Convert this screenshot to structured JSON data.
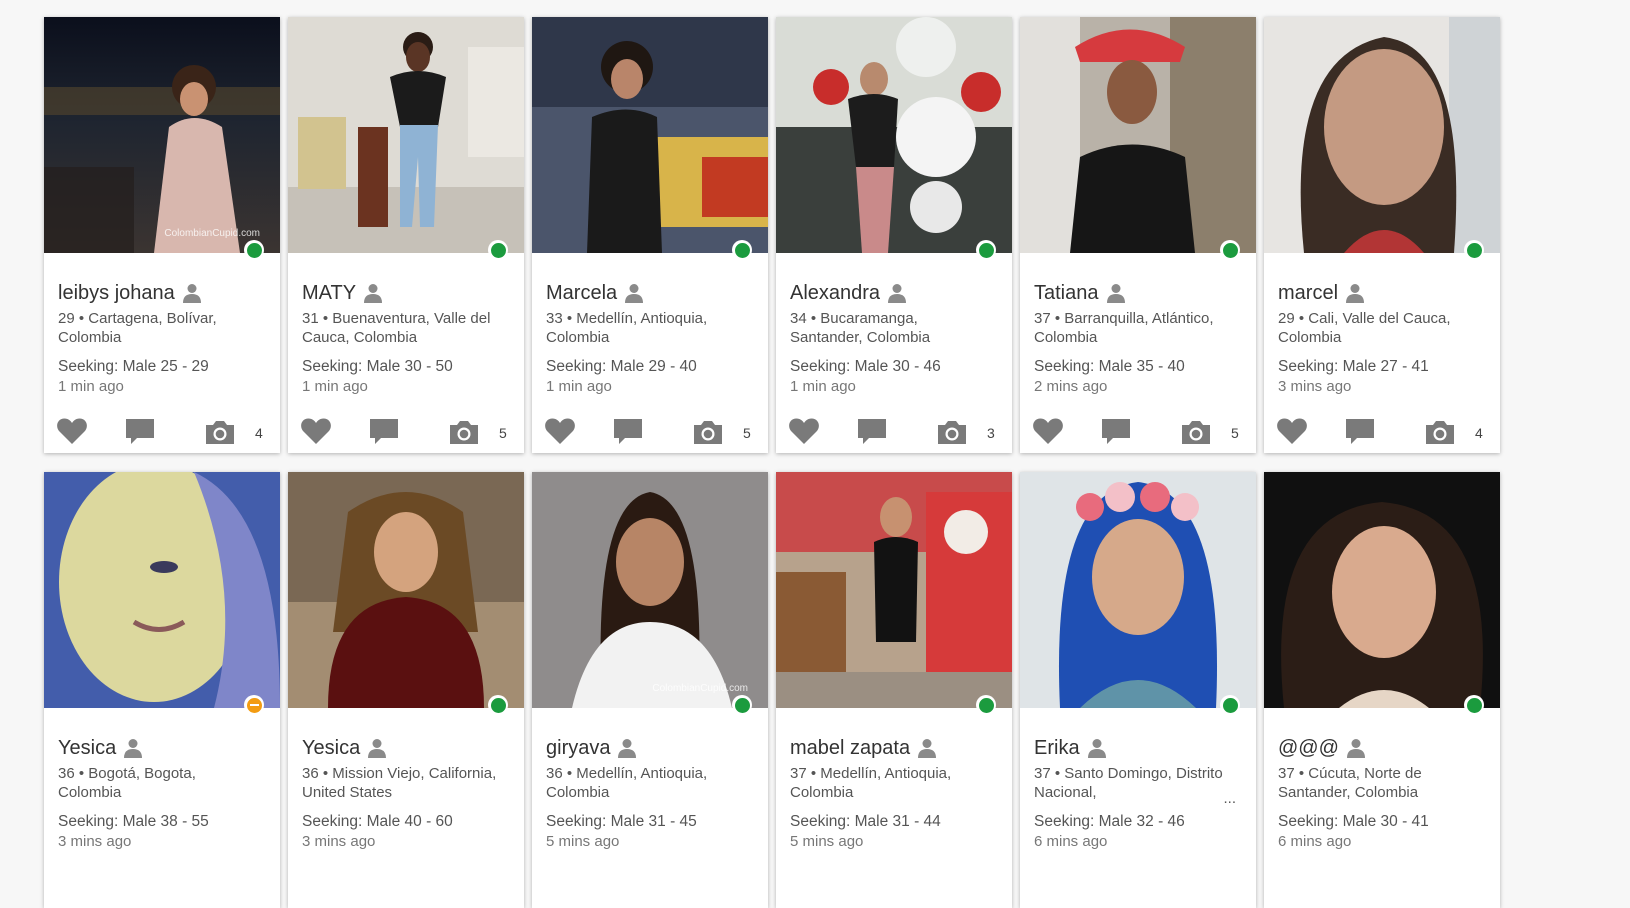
{
  "watermark": "ColombianCupid.com",
  "colors": {
    "online": "#1b9b3e",
    "away": "#f39c12",
    "icon": "#7a7a7a"
  },
  "icons": {
    "like": "heart-icon",
    "message": "chat-bubble-icon",
    "photos": "camera-icon",
    "profile": "person-icon"
  },
  "profiles": [
    {
      "name": "leibys johana",
      "location": "29 • Cartagena, Bolívar, Colombia",
      "seeking": "Seeking: Male 25 - 29",
      "last_active": "1 min ago",
      "photo_count": "4",
      "status": "online"
    },
    {
      "name": "MATY",
      "location": "31 • Buenaventura, Valle del Cauca, Colombia",
      "seeking": "Seeking: Male 30 - 50",
      "last_active": "1 min ago",
      "photo_count": "5",
      "status": "online"
    },
    {
      "name": "Marcela",
      "location": "33 • Medellín, Antioquia, Colombia",
      "seeking": "Seeking: Male 29 - 40",
      "last_active": "1 min ago",
      "photo_count": "5",
      "status": "online"
    },
    {
      "name": "Alexandra",
      "location": "34 • Bucaramanga, Santander, Colombia",
      "seeking": "Seeking: Male 30 - 46",
      "last_active": "1 min ago",
      "photo_count": "3",
      "status": "online"
    },
    {
      "name": "Tatiana",
      "location": "37 • Barranquilla, Atlántico, Colombia",
      "seeking": "Seeking: Male 35 - 40",
      "last_active": "2 mins ago",
      "photo_count": "5",
      "status": "online"
    },
    {
      "name": "marcel",
      "location": "29 • Cali, Valle del Cauca, Colombia",
      "seeking": "Seeking: Male 27 - 41",
      "last_active": "3 mins ago",
      "photo_count": "4",
      "status": "online"
    },
    {
      "name": "Yesica",
      "location": "36 • Bogotá, Bogota, Colombia",
      "seeking": "Seeking: Male 38 - 55",
      "last_active": "3 mins ago",
      "photo_count": "",
      "status": "away"
    },
    {
      "name": "Yesica",
      "location": "36 • Mission Viejo, California, United States",
      "seeking": "Seeking: Male 40 - 60",
      "last_active": "3 mins ago",
      "photo_count": "",
      "status": "online"
    },
    {
      "name": "giryava",
      "location": "36 • Medellín, Antioquia, Colombia",
      "seeking": "Seeking: Male 31 - 45",
      "last_active": "5 mins ago",
      "photo_count": "",
      "status": "online"
    },
    {
      "name": "mabel zapata",
      "location": "37 • Medellín, Antioquia, Colombia",
      "seeking": "Seeking: Male 31 - 44",
      "last_active": "5 mins ago",
      "photo_count": "",
      "status": "online"
    },
    {
      "name": "Erika",
      "location": "37 • Santo Domingo, Distrito Nacional,",
      "location_more": "...",
      "seeking": "Seeking: Male 32 - 46",
      "last_active": "6 mins ago",
      "photo_count": "",
      "status": "online"
    },
    {
      "name": "@@@",
      "location": "37 • Cúcuta, Norte de Santander, Colombia",
      "seeking": "Seeking: Male 30 - 41",
      "last_active": "6 mins ago",
      "photo_count": "",
      "status": "online"
    }
  ]
}
